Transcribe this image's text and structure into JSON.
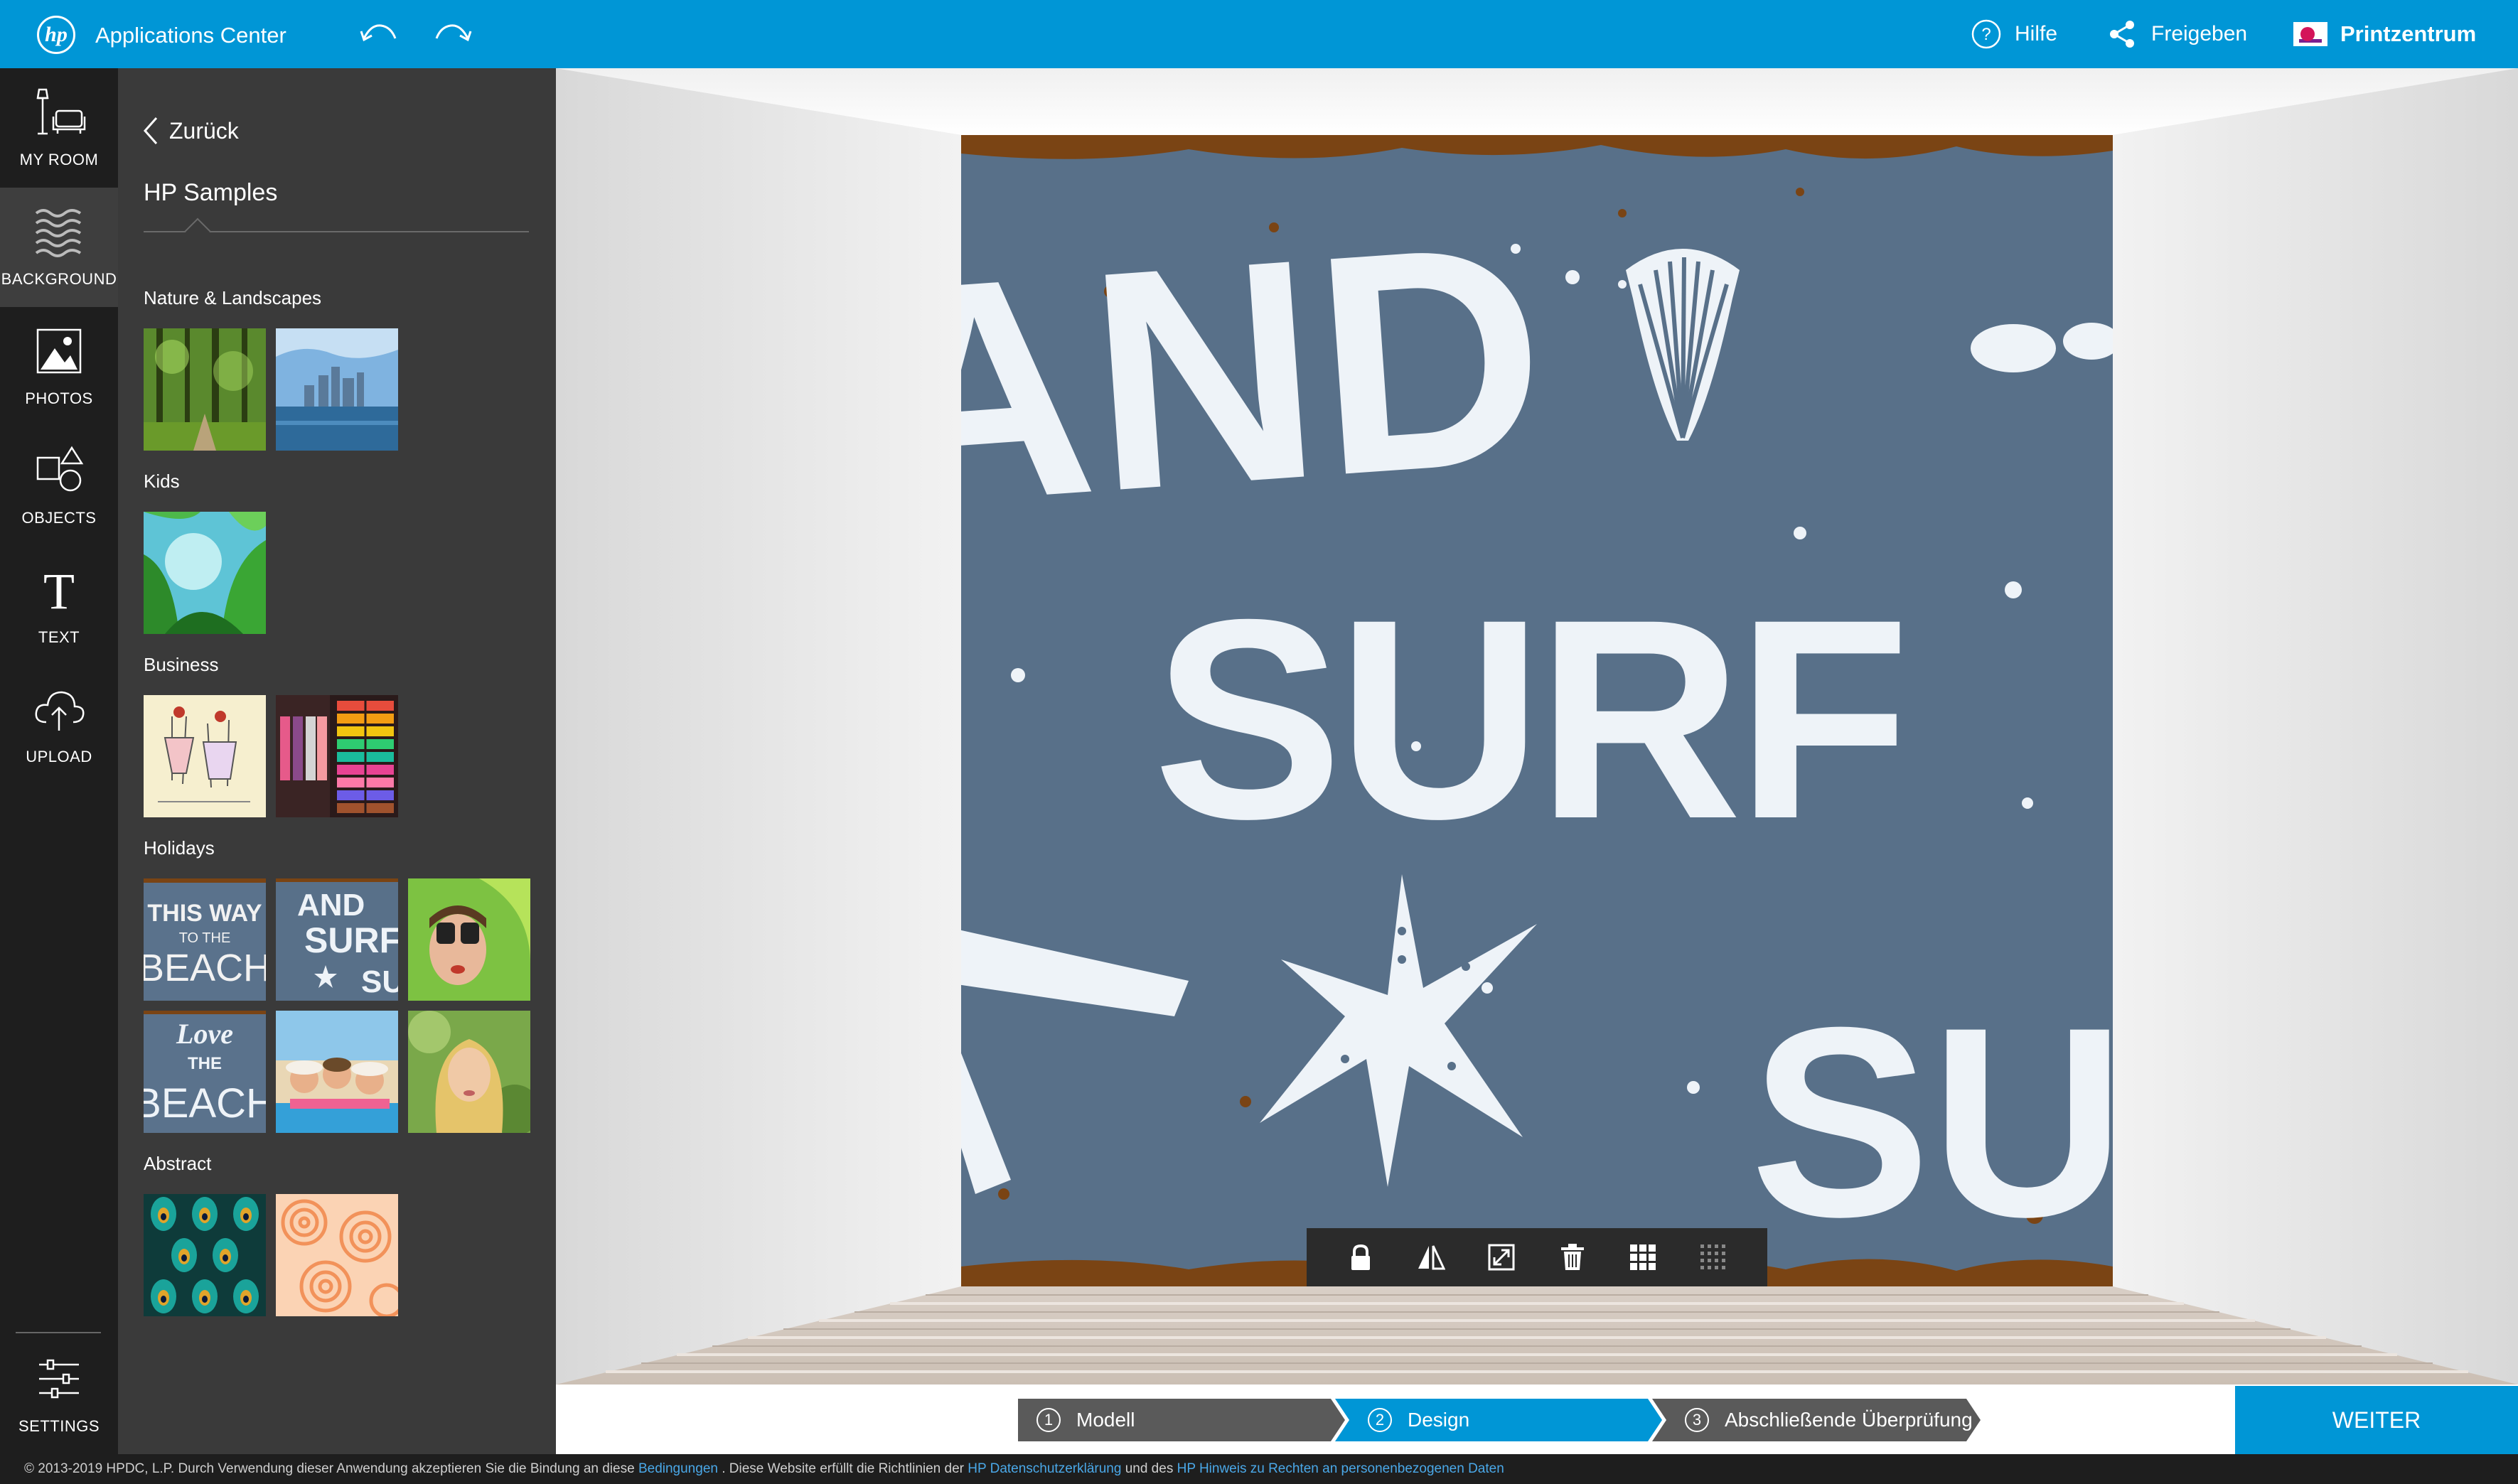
{
  "header": {
    "logo_text": "hp",
    "app_title": "Applications Center",
    "help_label": "Hilfe",
    "share_label": "Freigeben",
    "print_center_label": "Printzentrum"
  },
  "rail": {
    "items": [
      {
        "label": "MY ROOM",
        "icon": "room-icon"
      },
      {
        "label": "BACKGROUND",
        "icon": "background-texture-icon",
        "active": true
      },
      {
        "label": "PHOTOS",
        "icon": "photo-icon"
      },
      {
        "label": "OBJECTS",
        "icon": "shapes-icon"
      },
      {
        "label": "TEXT",
        "icon": "text-icon"
      },
      {
        "label": "UPLOAD",
        "icon": "cloud-upload-icon"
      }
    ],
    "settings_label": "SETTINGS"
  },
  "panel": {
    "back_label": "Zurück",
    "title": "HP Samples",
    "categories": [
      {
        "label": "Nature & Landscapes",
        "thumbs": [
          "forest",
          "city-skyline"
        ]
      },
      {
        "label": "Kids",
        "thumbs": [
          "jungle-leaves"
        ]
      },
      {
        "label": "Business",
        "thumbs": [
          "fashion-sketch",
          "clothing-shelves"
        ]
      },
      {
        "label": "Holidays",
        "thumbs": [
          "this-way-to-the-beach",
          "sand-surf",
          "binoculars-girl",
          "love-the-beach",
          "friends-on-beach",
          "blonde-woman"
        ]
      },
      {
        "label": "Abstract",
        "thumbs": [
          "peacock-pattern",
          "orange-swirls"
        ]
      }
    ],
    "thumb_texts": {
      "beach_line1": "THIS WAY",
      "beach_line2": "TO THE",
      "beach_line3": "BEACH",
      "sand_line1": "AND",
      "sand_line2": "SURF",
      "sand_line3": "SU",
      "love_line1": "Love",
      "love_line2": "THE",
      "love_line3": "BEACH"
    }
  },
  "canvas": {
    "wall_text_top": "AND",
    "wall_text_middle": "SURF",
    "wall_text_bottom": "SU",
    "toolbar": [
      "lock-icon",
      "mirror-icon",
      "resize-icon",
      "trash-icon",
      "grid-icon",
      "grid-fine-icon"
    ]
  },
  "steps": [
    {
      "number": "1",
      "label": "Modell",
      "state": "done"
    },
    {
      "number": "2",
      "label": "Design",
      "state": "active"
    },
    {
      "number": "3",
      "label": "Abschließende Überprüfung",
      "state": "pending"
    }
  ],
  "next_button": "WEITER",
  "footer": {
    "text1": "© 2013-2019 HPDC, L.P. Durch Verwendung dieser Anwendung akzeptieren Sie die Bindung an diese",
    "link1": "Bedingungen",
    "text2": ". Diese Website erfüllt die Richtlinien der",
    "link2": "HP Datenschutzerklärung",
    "text3": "und des",
    "link3": "HP Hinweis zu Rechten an personenbezogenen Daten"
  },
  "colors": {
    "accent": "#0096d6",
    "rail_bg": "#1e1e1e",
    "panel_bg": "#3a3a3a",
    "wall_blue": "#587089",
    "wall_rust": "#7a4414",
    "step_done": "#5a5a5a"
  }
}
